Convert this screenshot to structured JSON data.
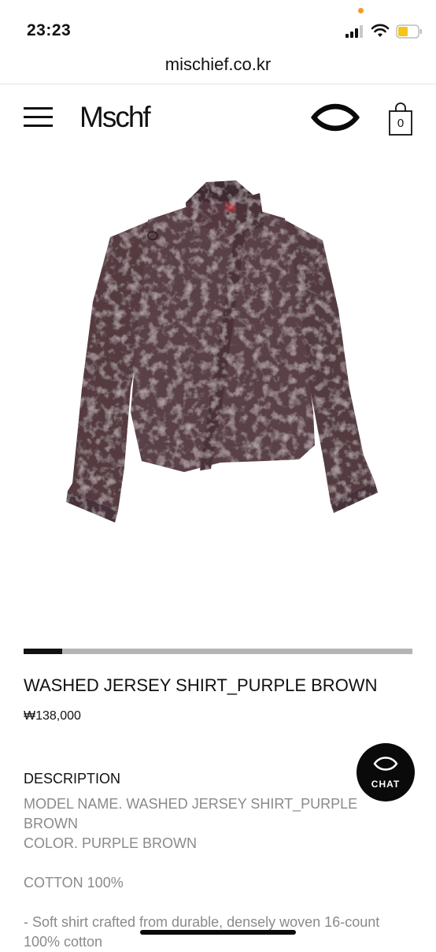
{
  "status_bar": {
    "time": "23:23",
    "battery_color": "#f5c518",
    "dot_color": "#f59a23"
  },
  "browser": {
    "url": "mischief.co.kr"
  },
  "header": {
    "logo": "Mschf",
    "cart_count": "0",
    "icons": [
      "menu-icon",
      "eye-logo-icon",
      "shopping-bag-icon"
    ]
  },
  "product": {
    "image_alt": "Washed jersey shirt in purple brown",
    "gallery_progress": 0.1,
    "title": "WASHED JERSEY SHIRT_PURPLE BROWN",
    "price": "₩138,000"
  },
  "description": {
    "heading": "DESCRIPTION",
    "lines": [
      "MODEL NAME. WASHED JERSEY SHIRT_PURPLE",
      "BROWN",
      "COLOR. PURPLE BROWN",
      "",
      "COTTON 100%",
      "",
      "- Soft shirt crafted from durable, densely woven 16-count",
      "100% cotton"
    ]
  },
  "chat": {
    "label": "CHAT"
  }
}
